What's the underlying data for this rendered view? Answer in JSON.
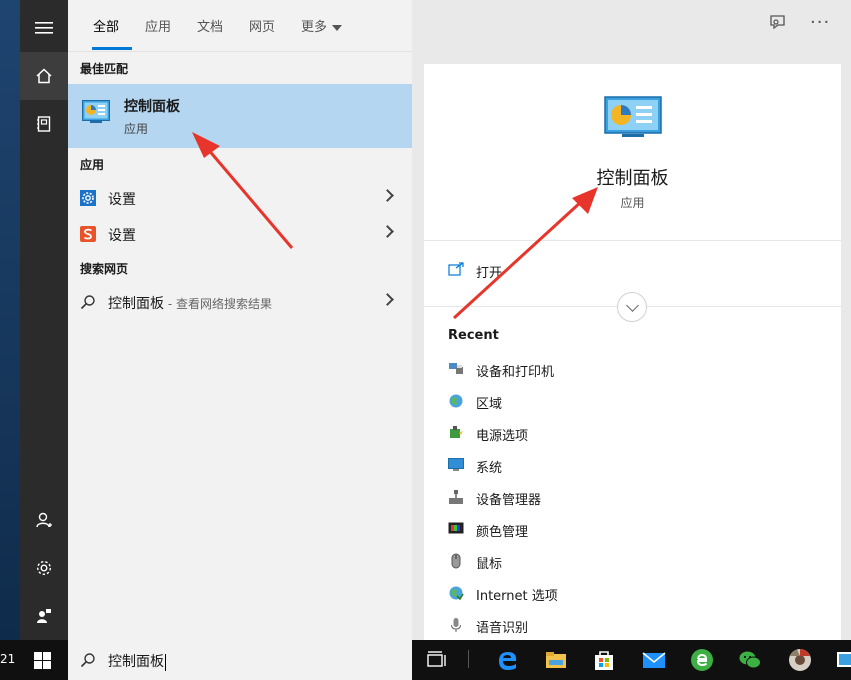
{
  "clock_fragment": "21",
  "tabs": [
    {
      "label": "全部",
      "active": true
    },
    {
      "label": "应用"
    },
    {
      "label": "文档"
    },
    {
      "label": "网页"
    },
    {
      "label": "更多"
    }
  ],
  "sections": {
    "best_match": "最佳匹配",
    "apps": "应用",
    "web": "搜索网页"
  },
  "best_match": {
    "title": "控制面板",
    "subtitle": "应用"
  },
  "apps": [
    {
      "label": "设置",
      "icon": "settings-gear-icon"
    },
    {
      "label": "设置",
      "icon": "sogou-s-icon"
    }
  ],
  "web_result": {
    "query": "控制面板",
    "suffix": " - 查看网络搜索结果"
  },
  "detail": {
    "title": "控制面板",
    "subtitle": "应用",
    "open_label": "打开",
    "recent_heading": "Recent",
    "recent_items": [
      "设备和打印机",
      "区域",
      "电源选项",
      "系统",
      "设备管理器",
      "颜色管理",
      "鼠标",
      "Internet 选项",
      "语音识别"
    ]
  },
  "search": {
    "value": "控制面板"
  },
  "colors": {
    "accent": "#0078d7",
    "highlight": "#b5d6f0",
    "arrow": "#e8352b"
  }
}
